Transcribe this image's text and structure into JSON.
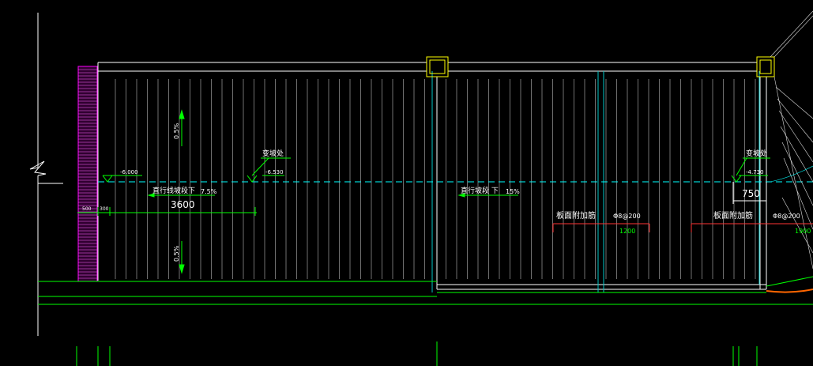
{
  "labels": {
    "slope_up": "0.5%",
    "slope_down": "0.5%",
    "elev_left": "-6.000",
    "elev_mid": "-6.530",
    "elev_right": "-4.730",
    "slope_change_1": "变坡处",
    "slope_change_2": "变坡处",
    "ramp_1": "直行线坡段下",
    "ramp_1_grade": "7.5%",
    "ramp_2": "直行坡段  下",
    "ramp_2_grade": "15%",
    "dim_3600": "3600",
    "dim_750": "750",
    "dim_500": "500",
    "dim_300": "300",
    "rebar_1": "板面附加筋",
    "rebar_1_spec": "Φ8@200",
    "rebar_1_len": "1200",
    "rebar_2": "板面附加筋",
    "rebar_2_spec": "Φ8@200",
    "rebar_2_len": "1900"
  },
  "colors": {
    "background": "#000000",
    "slab_outline": "#ffffff",
    "stair": "#ff00ff",
    "axis": "#00ff00",
    "water_line": "#00ffff",
    "column": "#ffff00",
    "rebar": "#ff3333",
    "text": "#ffffff",
    "curb": "#ff6600"
  }
}
